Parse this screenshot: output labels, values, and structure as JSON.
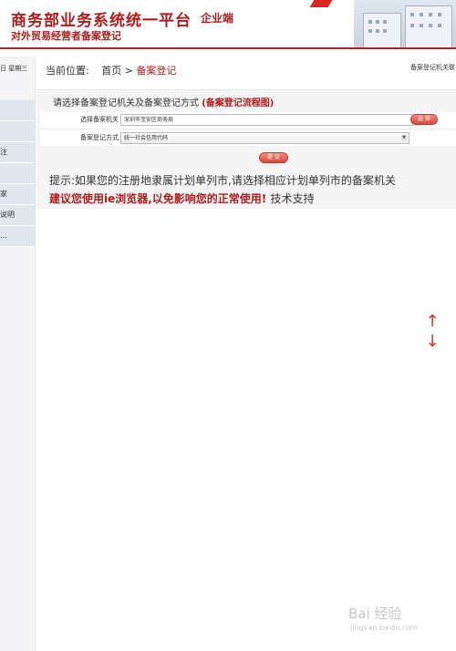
{
  "header": {
    "title": "商务部业务系统统一平台",
    "tag": "企业端",
    "subtitle": "对外贸易经营者备案登记"
  },
  "sidebar": {
    "date": "日 星期三",
    "items": [
      "",
      "",
      "注",
      "",
      "家",
      "说明",
      "…"
    ]
  },
  "location": {
    "label": "当前位置:",
    "home": "首页",
    "sep": ">",
    "current": "备案登记"
  },
  "right_link": "备案登记机关联",
  "panel": {
    "title": "请选择备案登记机关及备案登记方式",
    "flow_link": "(备案登记流程图)",
    "org_label": "选择备案机关",
    "org_value": "深圳市宝安区商务局",
    "select_button": "选 择",
    "method_label": "备案登记方式",
    "method_value": "统一社会信用代码",
    "submit_button": "提 交"
  },
  "tip": "提示:如果您的注册地隶属计划单列市,请选择相应计划单列市的备案机关",
  "warning": "建议您使用ie浏览器,以免影响您的正常使用!",
  "warning_tail": "技术支持",
  "scroll": {
    "up": "↑",
    "down": "↓"
  },
  "watermark": {
    "brand": "Bai 经验",
    "url": "jingyan.baidu.com"
  }
}
